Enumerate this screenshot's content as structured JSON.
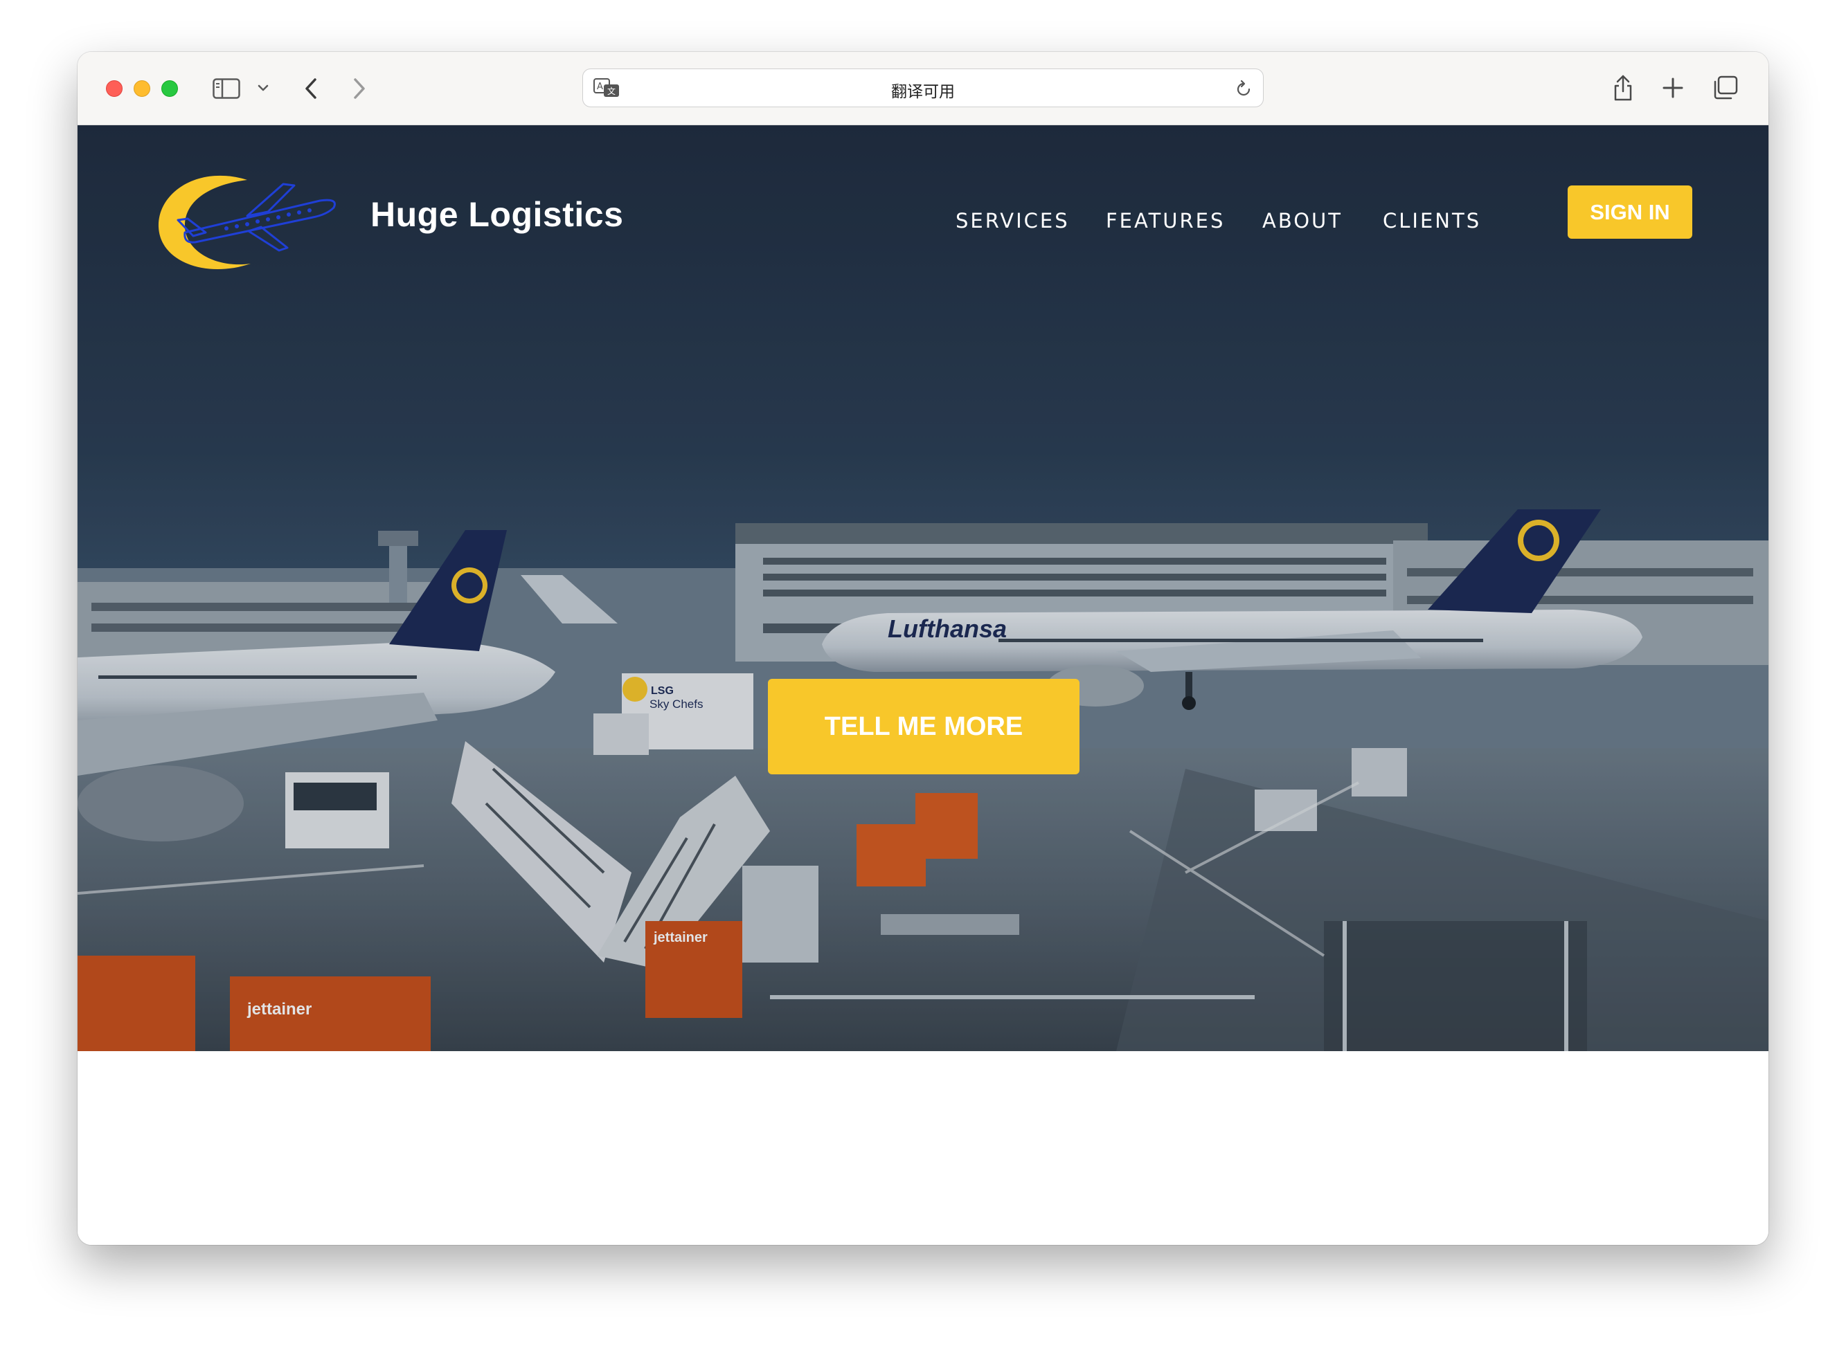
{
  "browser": {
    "address_text": "翻译可用"
  },
  "site": {
    "brand_name": "Huge Logistics",
    "nav": [
      "SERVICES",
      "FEATURES",
      "ABOUT",
      "CLIENTS"
    ],
    "sign_in_label": "SIGN IN",
    "cta_label": "TELL ME MORE"
  },
  "hero_image": {
    "airline_text": "Lufthansa",
    "catering_text": "LSG Sky Chefs",
    "container_text": "jettainer"
  },
  "colors": {
    "accent": "#f8c72a",
    "logo_plane": "#1f3fd6",
    "sky": "#243447"
  },
  "icons": [
    "sidebar-icon",
    "chevron-down-icon",
    "back-icon",
    "forward-icon",
    "translate-icon",
    "reload-icon",
    "share-icon",
    "plus-icon",
    "tabs-icon",
    "logo-plane-icon"
  ]
}
